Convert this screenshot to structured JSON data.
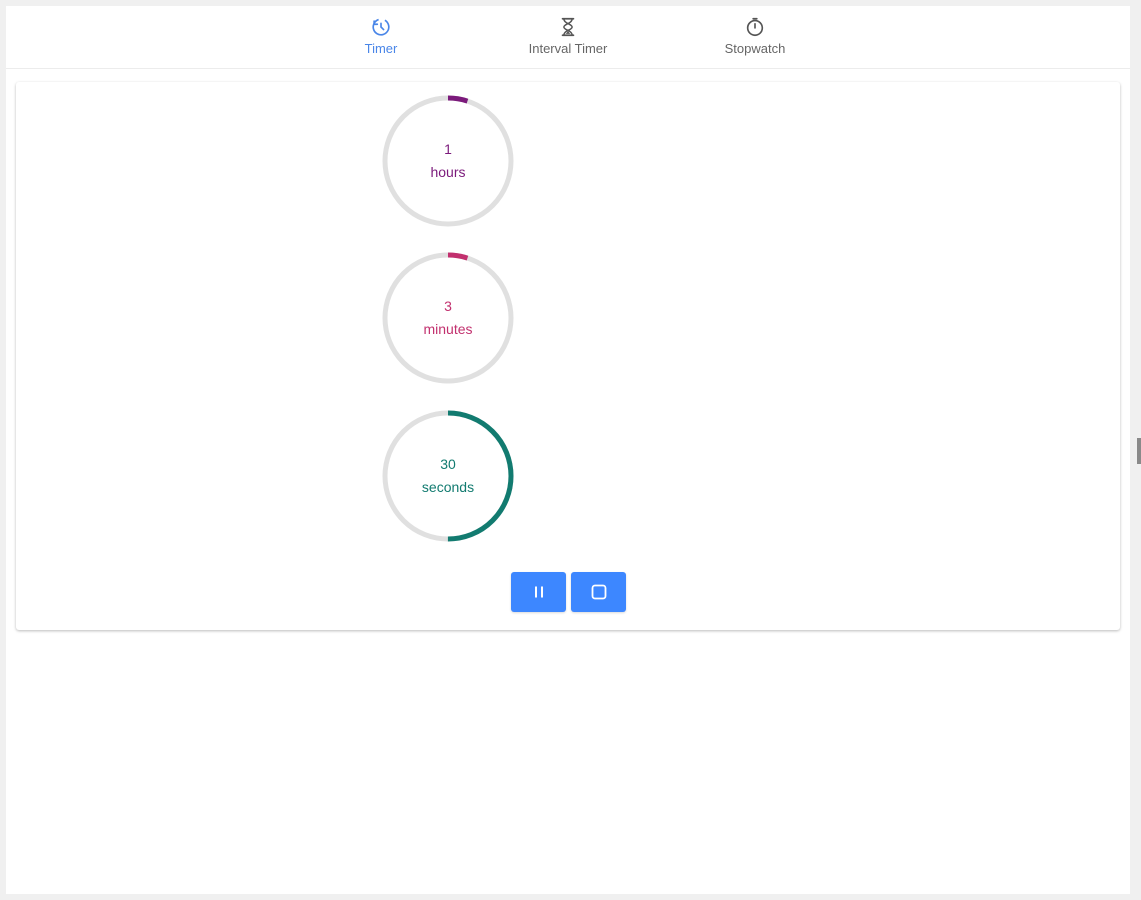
{
  "tabs": [
    {
      "label": "Timer",
      "icon": "timer-icon",
      "active": true
    },
    {
      "label": "Interval Timer",
      "icon": "hourglass-icon",
      "active": false
    },
    {
      "label": "Stopwatch",
      "icon": "stopwatch-icon",
      "active": false
    }
  ],
  "colors": {
    "accent": "#4a86e8",
    "button": "#3d87ff",
    "track": "#e0e0e0",
    "hours": "#7b1a7b",
    "minutes": "#c2306e",
    "seconds": "#127b70"
  },
  "timer": {
    "hours": {
      "value": "1",
      "unit": "hours",
      "progress": 0.05
    },
    "minutes": {
      "value": "3",
      "unit": "minutes",
      "progress": 0.05
    },
    "seconds": {
      "value": "30",
      "unit": "seconds",
      "progress": 0.5
    }
  },
  "controls": {
    "pause_icon": "pause-icon",
    "stop_icon": "stop-icon"
  }
}
